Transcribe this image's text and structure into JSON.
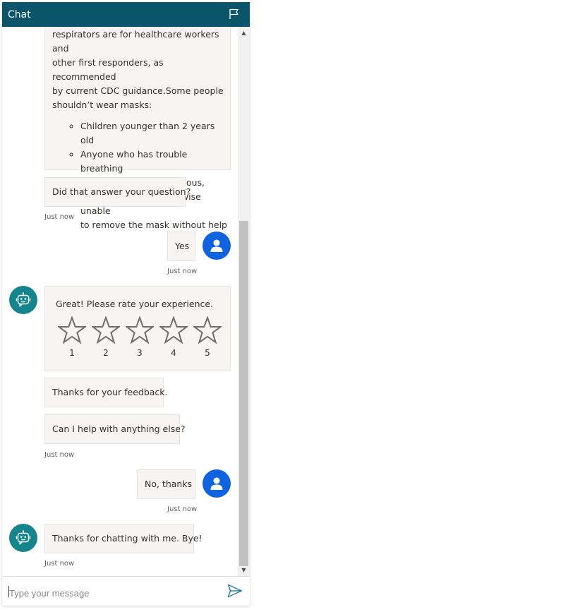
{
  "header": {
    "title": "Chat",
    "flag_icon": "flag-icon"
  },
  "messages": {
    "bot_answer": {
      "lines": [
        "respirators are for healthcare workers and",
        "other first responders, as recommended",
        "by current CDC guidance.Some people",
        "shouldn’t wear masks:"
      ],
      "bullets": [
        "Children younger than 2 years old",
        "Anyone who has trouble breathing",
        "Anyone who is unconscious,",
        "incapacitated, or otherwise unable",
        "to remove the mask without help"
      ]
    },
    "bot_question": "Did that answer your question?",
    "bot_question_time": "Just now",
    "user_yes": "Yes",
    "user_yes_time": "Just now",
    "rating": {
      "prompt": "Great! Please rate your experience.",
      "stars": [
        "1",
        "2",
        "3",
        "4",
        "5"
      ]
    },
    "bot_feedback": "Thanks for your feedback.",
    "bot_help": "Can I help with anything else?",
    "bot_help_time": "Just now",
    "user_no": "No, thanks",
    "user_no_time": "Just now",
    "bot_bye": "Thanks for chatting with me. Bye!",
    "bot_bye_time": "Just now"
  },
  "composer": {
    "placeholder": "Type your message",
    "send_icon": "send-icon"
  },
  "colors": {
    "header": "#0b556a",
    "bot_avatar": "#14858c",
    "user_avatar": "#0f62e0",
    "send": "#2d7fa3"
  }
}
